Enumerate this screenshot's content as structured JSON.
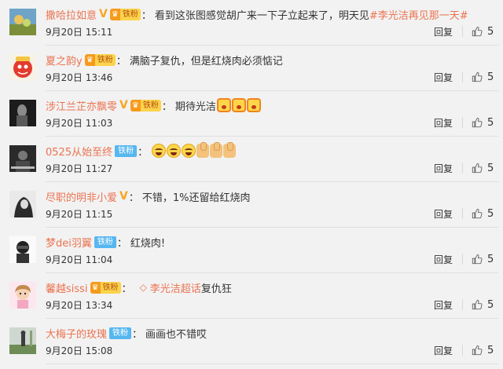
{
  "colors": {
    "username": "#eb7350",
    "topic": "#eb7350",
    "fan_orange": "#f59b1c",
    "fan_blue": "#56b7f0",
    "vip": "#f5a623"
  },
  "ui": {
    "reply_label": "回复",
    "colon": "："
  },
  "comments": [
    {
      "username": "撒哈拉如意",
      "text": "看到这张图感觉胡广来一下子立起来了，明天见",
      "topic": "#李光洁再见那一天#",
      "time": "9月20日 15:11",
      "likes": "5",
      "fan_badge": "铁粉"
    },
    {
      "username": "夏之韵y",
      "text": "满脑子复仇，但是红烧肉必须惦记",
      "time": "9月20日 13:46",
      "likes": "5",
      "fan_badge": "铁粉"
    },
    {
      "username": "涉江兰芷亦飘零",
      "text": "期待光洁",
      "time": "9月20日 11:03",
      "likes": "5",
      "fan_badge": "铁粉"
    },
    {
      "username": "0525从始至终",
      "time": "9月20日 11:27",
      "likes": "5",
      "fan_badge": "铁粉"
    },
    {
      "username": "尽职的明非小爱",
      "text": "不错，1%还留给红烧肉",
      "time": "9月20日 11:15",
      "likes": "5"
    },
    {
      "username": "梦dei羽翼",
      "text": "红烧肉!",
      "time": "9月20日 11:04",
      "likes": "5",
      "fan_badge": "铁粉"
    },
    {
      "username": "馨越sissi",
      "supertopic": "李光洁超话",
      "text": "复仇狂",
      "time": "9月20日 13:34",
      "likes": "5",
      "fan_badge": "铁粉"
    },
    {
      "username": "大梅子的玫瑰",
      "text": "画画也不错哎",
      "time": "9月20日 15:08",
      "likes": "5",
      "fan_badge": "铁粉"
    }
  ]
}
